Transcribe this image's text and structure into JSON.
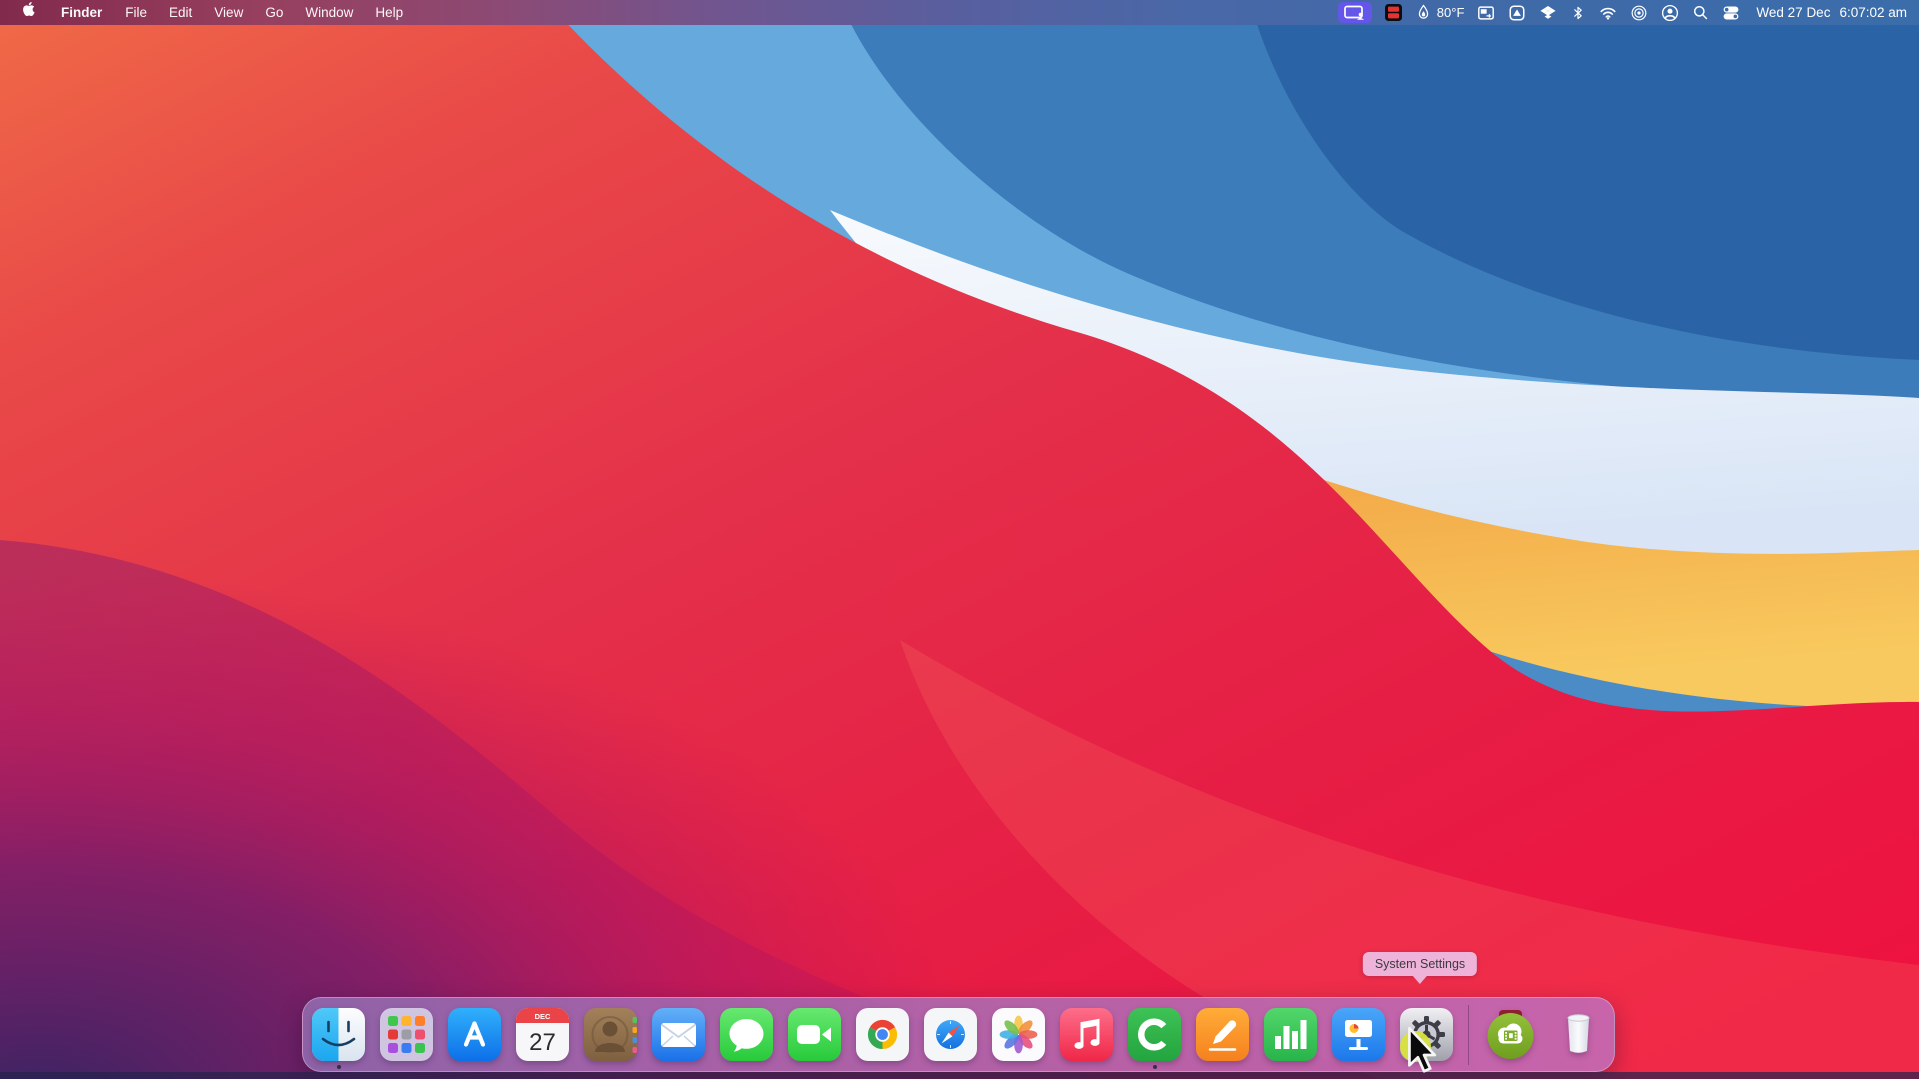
{
  "menubar": {
    "left_items": [
      {
        "name": "apple-menu",
        "icon": "apple-logo"
      },
      {
        "name": "app-menu-finder",
        "label": "Finder",
        "bold": true
      },
      {
        "name": "menu-file",
        "label": "File"
      },
      {
        "name": "menu-edit",
        "label": "Edit"
      },
      {
        "name": "menu-view",
        "label": "View"
      },
      {
        "name": "menu-go",
        "label": "Go"
      },
      {
        "name": "menu-window",
        "label": "Window"
      },
      {
        "name": "menu-help",
        "label": "Help"
      }
    ],
    "status_items": [
      {
        "name": "screen-share-indicator",
        "icon": "screen-share",
        "highlight": "#6456e8"
      },
      {
        "name": "screen-record-indicator",
        "icon": "record-film"
      },
      {
        "name": "weather-item",
        "icon": "flame",
        "label": "80°F"
      },
      {
        "name": "window-arrange-item",
        "icon": "window-arrange"
      },
      {
        "name": "triangle-app-item",
        "icon": "triangle-app"
      },
      {
        "name": "dropbox-item",
        "icon": "dropbox"
      },
      {
        "name": "bluetooth-item",
        "icon": "bluetooth"
      },
      {
        "name": "wifi-item",
        "icon": "wifi"
      },
      {
        "name": "hotspot-item",
        "icon": "hotspot"
      },
      {
        "name": "user-account-item",
        "icon": "user-account"
      },
      {
        "name": "spotlight-item",
        "icon": "search"
      },
      {
        "name": "control-center-item",
        "icon": "control-center"
      }
    ],
    "clock": {
      "date": "Wed 27 Dec",
      "time": "6:07:02 am"
    }
  },
  "tooltip": {
    "label": "System Settings",
    "target": "system-settings"
  },
  "dock": {
    "items": [
      {
        "name": "finder",
        "running": true
      },
      {
        "name": "launchpad"
      },
      {
        "name": "app-store"
      },
      {
        "name": "calendar",
        "badge_month": "DEC",
        "badge_day": "27"
      },
      {
        "name": "contacts"
      },
      {
        "name": "mail"
      },
      {
        "name": "messages"
      },
      {
        "name": "facetime"
      },
      {
        "name": "chrome"
      },
      {
        "name": "safari"
      },
      {
        "name": "photos"
      },
      {
        "name": "music"
      },
      {
        "name": "camtasia",
        "running": true
      },
      {
        "name": "pages"
      },
      {
        "name": "numbers"
      },
      {
        "name": "keynote"
      },
      {
        "name": "system-settings",
        "hovered": true
      },
      {
        "type": "divider"
      },
      {
        "name": "cloud-recorder"
      },
      {
        "name": "trash"
      }
    ]
  },
  "colors": {
    "menubar_left": "#822a4c",
    "menubar_right": "#3b6dab",
    "screen_share_pill": "#6456e8",
    "record_red": "#e53334",
    "dock_tint_left": "#946eb2",
    "dock_tint_right": "#c06cbc",
    "tooltip_bg": "#eeb3d9",
    "click_highlight": "#d9e33c",
    "wallpaper_blue_light": "#66a9dc",
    "wallpaper_blue_dark": "#2b64a6",
    "wallpaper_white_band": "#eef3fb",
    "wallpaper_orange": "#ef8f35",
    "wallpaper_red": "#e4304a",
    "wallpaper_crimson": "#ee1240",
    "wallpaper_purple": "#3a2464"
  }
}
